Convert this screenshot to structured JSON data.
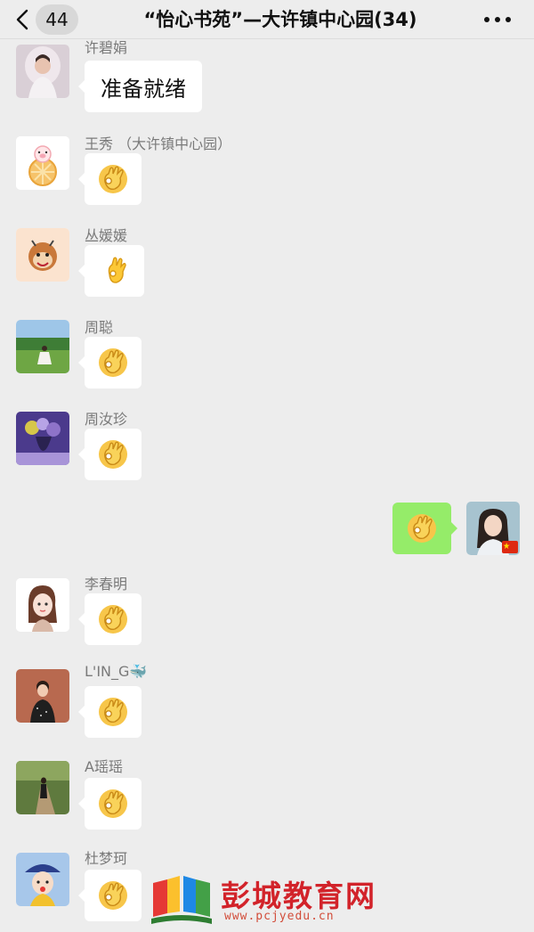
{
  "header": {
    "back_icon": "chevron-left-icon",
    "unread_count": "44",
    "title": "“怡心书苑”—大许镇中心园(34)",
    "more_icon": "more-dots-icon"
  },
  "messages": [
    {
      "sender": "许碧娟",
      "type": "text",
      "text": "准备就绪",
      "avatar": "bride-photo"
    },
    {
      "sender": "王秀 （大许镇中心园）",
      "type": "emoji",
      "emoji": "ok-hand",
      "avatar": "cartoon-pig-orange"
    },
    {
      "sender": "丛媛媛",
      "type": "emoji",
      "emoji": "ok-hand-emoji",
      "avatar": "cartoon-monkey"
    },
    {
      "sender": "周聪",
      "type": "emoji",
      "emoji": "ok-hand",
      "avatar": "girl-on-grass"
    },
    {
      "sender": "周汝珍",
      "type": "emoji",
      "emoji": "ok-hand",
      "avatar": "purple-flowers"
    },
    {
      "sender": "",
      "type": "emoji",
      "self": true,
      "emoji": "ok-hand",
      "avatar": "self-portrait-china-flag"
    },
    {
      "sender": "李春明",
      "type": "emoji",
      "emoji": "ok-hand",
      "avatar": "cartoon-girl"
    },
    {
      "sender": "L'IN_G🐳",
      "type": "emoji",
      "emoji": "ok-hand",
      "avatar": "person-red-background"
    },
    {
      "sender": "A瑶瑶",
      "type": "emoji",
      "emoji": "ok-hand",
      "avatar": "woman-on-path"
    },
    {
      "sender": "杜梦珂",
      "type": "emoji",
      "emoji": "ok-hand",
      "avatar": "cartoon-girl-hat"
    }
  ],
  "watermark": {
    "name": "彭城教育网",
    "url": "www.pcjyedu.cn"
  },
  "colors": {
    "background": "#ededed",
    "self_bubble": "#95ec69",
    "other_bubble": "#ffffff",
    "watermark_red": "#d2232a"
  }
}
